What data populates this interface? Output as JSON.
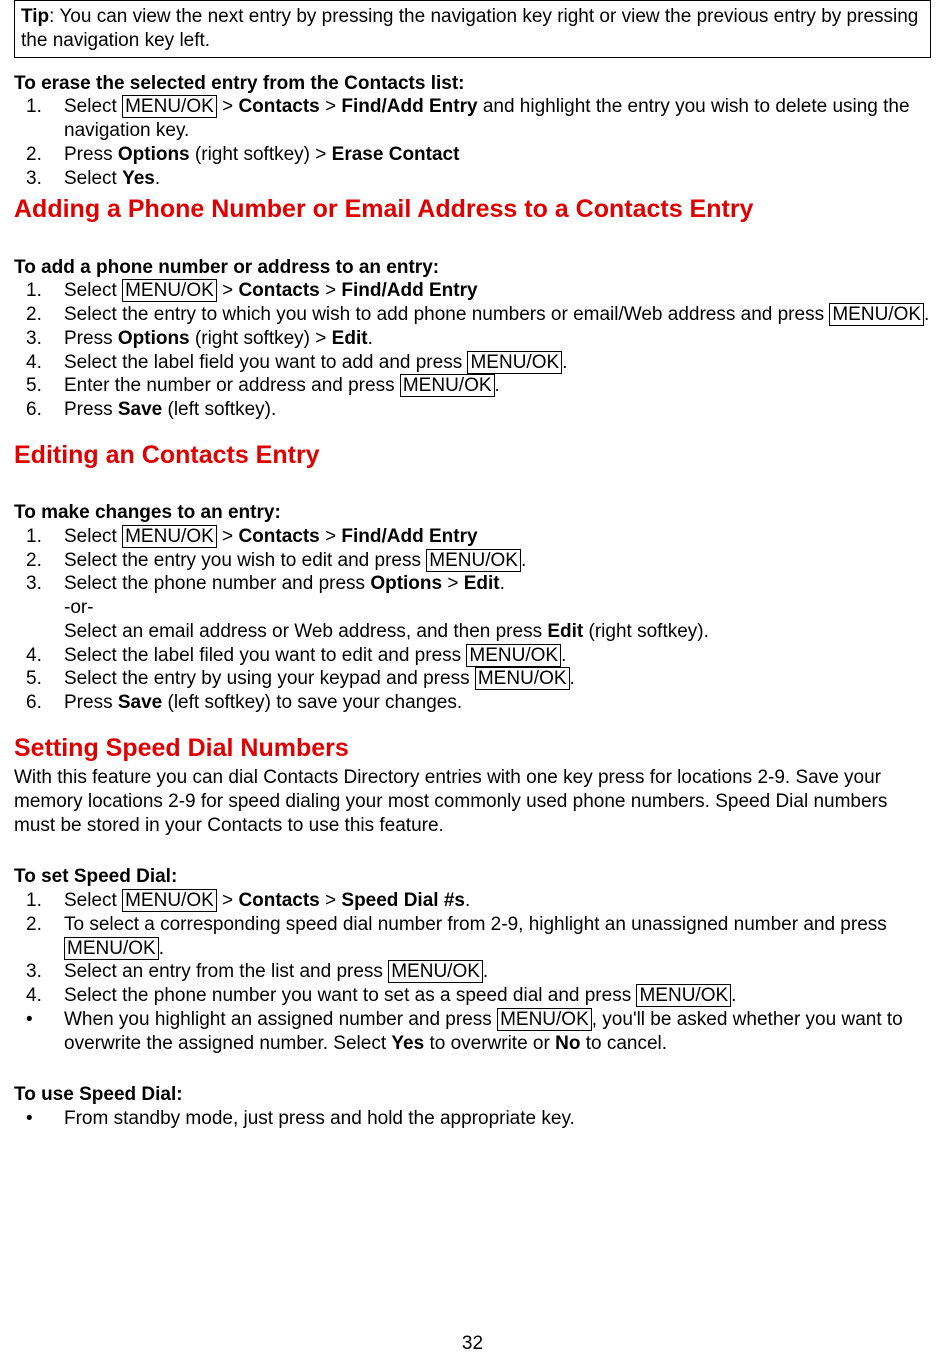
{
  "tip": {
    "label": "Tip",
    "text": ": You can view the next entry by pressing the navigation key right or view the previous entry by pressing the navigation key left."
  },
  "erase": {
    "title": "To erase the selected entry from the Contacts list:",
    "s1a": "Select ",
    "menu": "MENU/OK",
    "gt": " > ",
    "contacts": "Contacts",
    "findadd": "Find/Add Entry",
    "s1b": " and highlight the entry you wish to delete using the navigation key.",
    "s2a": "Press ",
    "options": "Options",
    "s2b": " (right softkey) > ",
    "erasecontact": "Erase Contact",
    "s3a": "Select ",
    "yes": "Yes",
    "s3b": "."
  },
  "heading_add": "Adding a Phone Number or Email Address to a Contacts Entry",
  "add": {
    "title": "To add a phone number or address to an entry:",
    "s1a": "Select ",
    "menu": "MENU/OK",
    "gt": " > ",
    "contacts": "Contacts",
    "findadd": "Find/Add Entry",
    "s2a": "Select the entry to which you wish to add phone numbers or email/Web address and press ",
    "s2b": ".",
    "s3a": "Press ",
    "options": "Options",
    "s3b": " (right softkey) > ",
    "edit": "Edit",
    "s3c": ".",
    "s4a": "Select the label field you want to add and press ",
    "s4b": ".",
    "s5a": "Enter the number or address and press ",
    "s5b": ".",
    "s6a": "Press ",
    "save": "Save",
    "s6b": " (left softkey)."
  },
  "heading_edit": "Editing an Contacts Entry",
  "editsec": {
    "title": "To make changes to an entry:",
    "s1a": "Select ",
    "menu": "MENU/OK",
    "gt": " > ",
    "contacts": "Contacts",
    "findadd": "Find/Add Entry",
    "s2a": "Select the entry you wish to edit and press ",
    "s2b": ".",
    "s3a": "Select the phone number and press ",
    "options": "Options",
    "s3gt": " > ",
    "edit": "Edit",
    "s3b": ".",
    "or": "-or-",
    "s3c1": "Select an email address or Web address, and then press ",
    "s3c2": " (right softkey).",
    "s4a": "Select the label filed you want to edit and press ",
    "s4b": ".",
    "s5a": "Select the entry by using your keypad and press ",
    "s5b": ".",
    "s6a": "Press ",
    "save": "Save",
    "s6b": " (left softkey) to save your changes."
  },
  "heading_speed": "Setting Speed Dial Numbers",
  "speed_intro": "With this feature you can dial Contacts Directory entries with one key press for locations 2-9. Save your memory locations 2-9 for speed dialing your most commonly used phone numbers. Speed Dial numbers must be stored in your Contacts to use this feature.",
  "setspeed": {
    "title": "To set Speed Dial:",
    "s1a": "Select ",
    "menu": "MENU/OK",
    "gt": " > ",
    "contacts": "Contacts",
    "speeddial": "Speed Dial #s",
    "s1b": ".",
    "s2a": "To select a corresponding speed dial number from 2-9, highlight an unassigned number and press ",
    "s2b": ".",
    "s3a": "Select an entry from the list and press ",
    "s3b": ".",
    "s4a": "Select the phone number you want to set as a speed dial and press ",
    "s4b": ".",
    "b1a": "When you highlight an assigned number and press ",
    "b1b": ", you'll be asked whether you want to overwrite the assigned number. Select ",
    "yes": "Yes",
    "b1c": " to overwrite or ",
    "no": "No",
    "b1d": " to cancel."
  },
  "usespeed": {
    "title": "To use Speed Dial:",
    "b1": "From standby mode, just press and hold the appropriate key."
  },
  "pagenum": "32",
  "nums": {
    "n1": "1.",
    "n2": "2.",
    "n3": "3.",
    "n4": "4.",
    "n5": "5.",
    "n6": "6.",
    "bullet": "•"
  }
}
